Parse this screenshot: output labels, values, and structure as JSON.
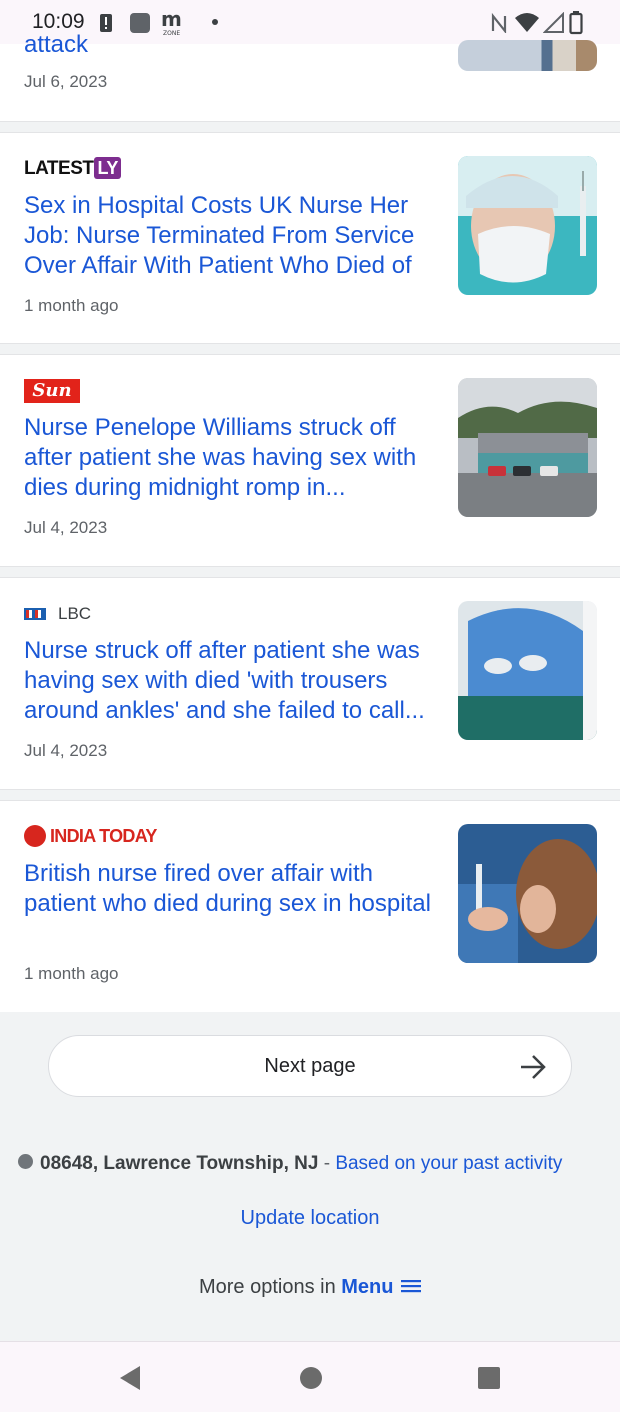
{
  "status_bar": {
    "time": "10:09",
    "left_icons": [
      "alert-icon",
      "square-app-icon",
      "m-zone-icon",
      "dot-icon"
    ],
    "right_icons": [
      "nfc-icon",
      "wifi-icon",
      "signal-icon",
      "battery-icon"
    ]
  },
  "articles": [
    {
      "title_partial": "attack",
      "date": "Jul 6, 2023"
    },
    {
      "source": "LATEST",
      "source_badge": "LY",
      "title": "Sex in Hospital Costs UK Nurse Her Job: Nurse Terminated From Service Over Affair With Patient Who Died of",
      "date": "1 month ago"
    },
    {
      "source": "Sun",
      "title": "Nurse Penelope Williams struck off after patient she was having sex with dies during midnight romp in...",
      "date": "Jul 4, 2023"
    },
    {
      "source": "LBC",
      "title": "Nurse struck off after patient she was having sex with died 'with trousers around ankles' and she failed to call...",
      "date": "Jul 4, 2023"
    },
    {
      "source": "INDIA TODAY",
      "title": "British nurse fired over affair with patient who died during sex in hospital",
      "date": "1 month ago"
    }
  ],
  "pagination": {
    "next_label": "Next page"
  },
  "location": {
    "place": "08648, Lawrence Township, NJ",
    "separator": "-",
    "basis": "Based on your past activity",
    "update_label": "Update location"
  },
  "footer": {
    "more_prefix": "More options in",
    "menu_label": "Menu"
  },
  "colors": {
    "link": "#1a57d6",
    "background": "#f1f3f4",
    "card": "#ffffff"
  }
}
